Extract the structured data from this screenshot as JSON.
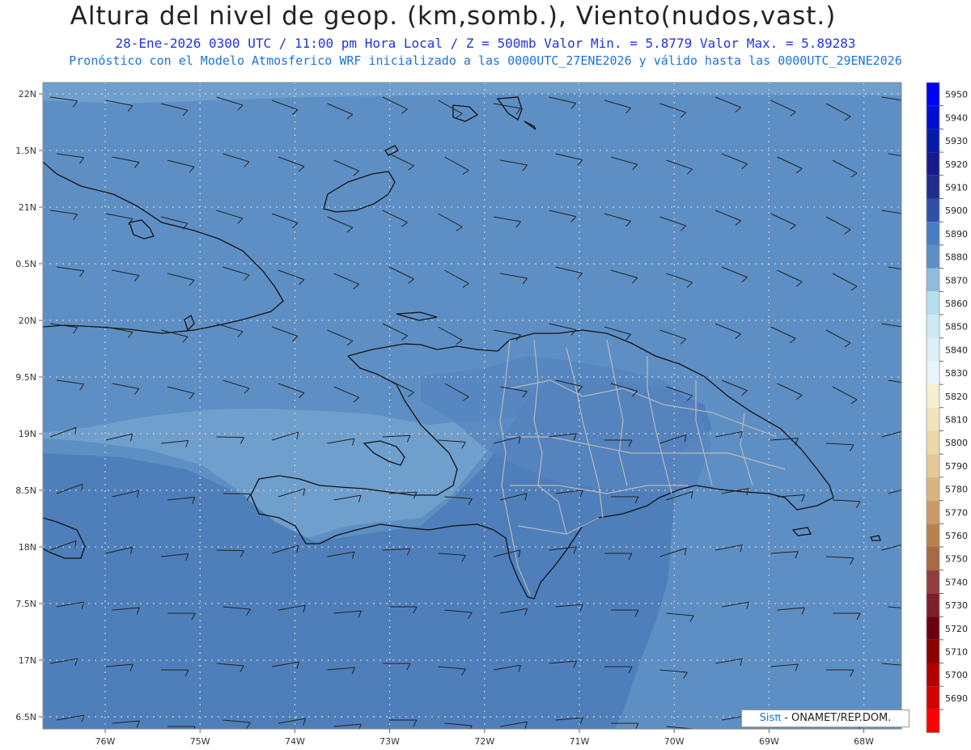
{
  "header": {
    "title": "Altura del nivel de geop. (km,somb.), Viento(nudos,vast.)",
    "line1": "28-Ene-2026  0300 UTC / 11:00 pm Hora Local / Z = 500mb    Valor Min. = 5.8779  Valor Max. = 5.89283",
    "line2": "Pronóstico con el Modelo Atmosferico WRF inicializado a las 0000UTC_27ENE2026 y válido hasta las  0000UTC_29ENE2026"
  },
  "map": {
    "lat_labels": [
      "22N",
      "1.5N",
      "21N",
      "0.5N",
      "20N",
      "9.5N",
      "19N",
      "8.5N",
      "18N",
      "7.5N",
      "17N",
      "6.5N"
    ],
    "lon_labels": [
      "76W",
      "75W",
      "74W",
      "73W",
      "72W",
      "71W",
      "70W",
      "69W",
      "68W"
    ],
    "colors": {
      "shade_light": "#6f9fcc",
      "shade_mid": "#5e8fc4",
      "shade_dark": "#4f7fbb",
      "coast": "#111111",
      "borders": "#b9b9b9",
      "grid": "#c8c8c8",
      "barb": "#222222"
    }
  },
  "colorbar": {
    "labels": [
      "5950",
      "5940",
      "5930",
      "5920",
      "5910",
      "5900",
      "5890",
      "5880",
      "5870",
      "5860",
      "5850",
      "5840",
      "5830",
      "5820",
      "5810",
      "5800",
      "5790",
      "5780",
      "5770",
      "5760",
      "5750",
      "5740",
      "5730",
      "5720",
      "5710",
      "5700",
      "5690"
    ],
    "colors": [
      "#0000f5",
      "#0010d0",
      "#0a1aa8",
      "#161a8a",
      "#1f2e8c",
      "#3050a8",
      "#4a7cc0",
      "#5e8fc4",
      "#8fbbdd",
      "#b8ddec",
      "#cce9f1",
      "#dcf0f6",
      "#e8f6fa",
      "#f6efcf",
      "#f1e4bd",
      "#ebd7a8",
      "#e4c996",
      "#d8b483",
      "#c99a68",
      "#b8824f",
      "#a66a45",
      "#913e3c",
      "#7b1f2a",
      "#6b0010",
      "#8c0000",
      "#b00000",
      "#d30000",
      "#ff0000"
    ]
  },
  "footer": {
    "logo_sis": "Sis",
    "logo_pi": "π",
    "logo_text": " - ONAMET/REP.DOM."
  }
}
